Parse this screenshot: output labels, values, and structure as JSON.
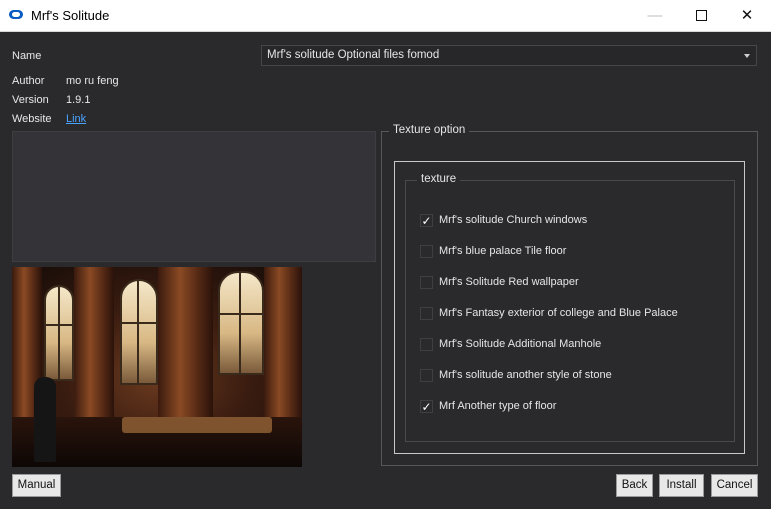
{
  "window": {
    "title": "Mrf's Solitude",
    "minimize_glyph": "—",
    "close_glyph": "✕"
  },
  "info": {
    "name_label": "Name",
    "author_label": "Author",
    "author_value": "mo ru feng",
    "version_label": "Version",
    "version_value": "1.9.1",
    "website_label": "Website",
    "website_link": "Link"
  },
  "name_select": {
    "value": "Mrf's solitude Optional files fomod"
  },
  "option_group": {
    "title": "Texture option",
    "subgroup_title": "texture",
    "options": [
      {
        "label": "Mrf's solitude Church windows",
        "checked": true
      },
      {
        "label": "Mrf's blue palace Tile floor",
        "checked": false
      },
      {
        "label": "Mrf's Solitude Red wallpaper",
        "checked": false
      },
      {
        "label": "Mrf's Fantasy exterior of college and Blue Palace",
        "checked": false
      },
      {
        "label": "Mrf's Solitude Additional Manhole",
        "checked": false
      },
      {
        "label": "Mrf's solitude another style of stone",
        "checked": false
      },
      {
        "label": "Mrf Another type of floor",
        "checked": true
      }
    ]
  },
  "buttons": {
    "manual": "Manual",
    "back": "Back",
    "install": "Install",
    "cancel": "Cancel"
  },
  "colors": {
    "background": "#2a2a2d",
    "titlebar": "#ffffff",
    "link": "#4aa3ff",
    "app_icon": "#0a5cc2"
  },
  "icons": {
    "app": "app-logo-icon",
    "check": "✓"
  }
}
